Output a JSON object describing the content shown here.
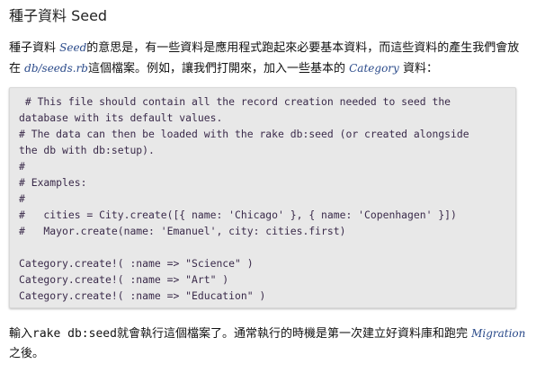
{
  "title": "種子資料 Seed",
  "intro": {
    "t1": "種子資料 ",
    "seed": "Seed",
    "t2": "的意思是，有一些資料是應用程式跑起來必要基本資料，而這些資料的產生我們會放在 ",
    "file": "db/seeds.rb",
    "t3": "這個檔案。例如，讓我們打開來，加入一些基本的 ",
    "category": "Category",
    "t4": " 資料："
  },
  "code": " # This file should contain all the record creation needed to seed the\ndatabase with its default values.\n# The data can then be loaded with the rake db:seed (or created alongside\nthe db with db:setup).\n#\n# Examples:\n#\n#   cities = City.create([{ name: 'Chicago' }, { name: 'Copenhagen' }])\n#   Mayor.create(name: 'Emanuel', city: cities.first)\n\nCategory.create!( :name => \"Science\" )\nCategory.create!( :name => \"Art\" )\nCategory.create!( :name => \"Education\" )",
  "outro": {
    "t1": "輸入",
    "cmd": "rake db:seed",
    "t2": "就會執行這個檔案了。通常執行的時機是第一次建立好資料庫和跑完 ",
    "migration": "Migration",
    "t3": "之後。"
  }
}
